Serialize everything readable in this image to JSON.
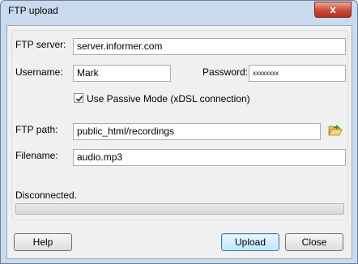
{
  "window": {
    "title": "FTP upload",
    "close_glyph": "x"
  },
  "form": {
    "ftp_server_label": "FTP server:",
    "ftp_server_value": "server.informer.com",
    "username_label": "Username:",
    "username_value": "Mark",
    "password_label": "Password:",
    "password_value": "xxxxxxxx",
    "passive_mode_label": "Use Passive Mode (xDSL connection)",
    "passive_mode_checked": true,
    "ftp_path_label": "FTP path:",
    "ftp_path_value": "public_html/recordings",
    "filename_label": "Filename:",
    "filename_value": "audio.mp3"
  },
  "status": {
    "text": "Disconnected.",
    "progress": 0
  },
  "buttons": {
    "help": "Help",
    "upload": "Upload",
    "close": "Close"
  },
  "icons": {
    "browse": "folder-open-icon",
    "checkmark": "checkmark-icon"
  },
  "colors": {
    "title_bar": "#c9daee",
    "close_button": "#c94a35",
    "dialog_bg": "#f0f0f0"
  }
}
